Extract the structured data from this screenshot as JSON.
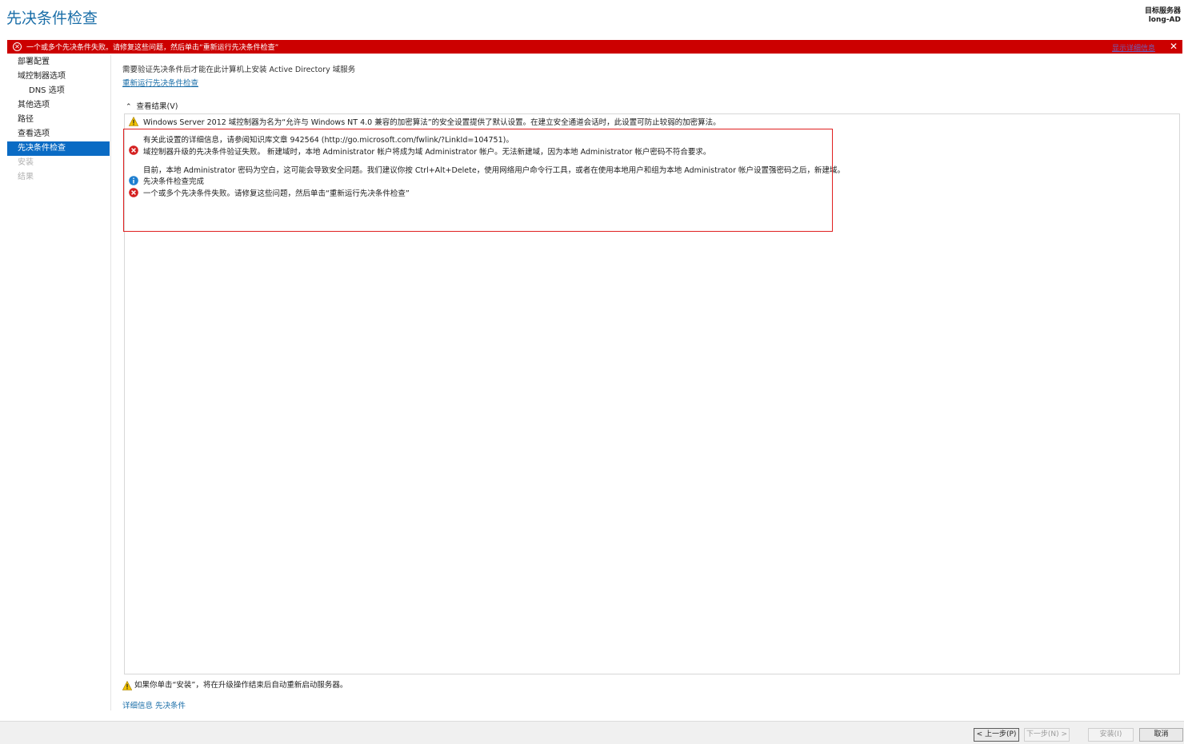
{
  "header": {
    "title": "先决条件检查",
    "target_label": "目标服务器",
    "target_server": "long-AD"
  },
  "banner": {
    "message": "一个或多个先决条件失败。请修复这些问题，然后单击“重新运行先决条件检查”",
    "detail_link": "显示详细信息",
    "close": "✕",
    "color": "#cc0000"
  },
  "nav": {
    "items": [
      {
        "label": "部署配置",
        "state": "normal"
      },
      {
        "label": "域控制器选项",
        "state": "normal"
      },
      {
        "label": "DNS 选项",
        "state": "sub"
      },
      {
        "label": "其他选项",
        "state": "normal"
      },
      {
        "label": "路径",
        "state": "normal"
      },
      {
        "label": "查看选项",
        "state": "normal"
      },
      {
        "label": "先决条件检查",
        "state": "active"
      },
      {
        "label": "安装",
        "state": "disabled"
      },
      {
        "label": "结果",
        "state": "disabled"
      }
    ]
  },
  "main": {
    "description": "需要验证先决条件后才能在此计算机上安装 Active Directory 域服务",
    "rerun_link": "重新运行先决条件检查",
    "view_results_label": "查看结果(V)",
    "results": [
      {
        "icon": "warning-icon",
        "text": "Windows Server 2012 域控制器为名为“允许与 Windows NT 4.0 兼容的加密算法”的安全设置提供了默认设置。在建立安全通道会话时，此设置可防止较弱的加密算法。"
      },
      {
        "icon": "",
        "text": "有关此设置的详细信息，请参阅知识库文章 942564 (http://go.microsoft.com/fwlink/?LinkId=104751)。"
      },
      {
        "icon": "error-icon",
        "text": "域控制器升级的先决条件验证失败。 新建域时，本地 Administrator 帐户将成为域 Administrator 帐户。无法新建域，因为本地 Administrator 帐户密码不符合要求。"
      },
      {
        "icon": "",
        "text": "目前，本地 Administrator 密码为空白，这可能会导致安全问题。我们建议你按 Ctrl+Alt+Delete，使用网络用户命令行工具，或者在使用本地用户和组为本地 Administrator 帐户设置强密码之后，新建域。"
      },
      {
        "icon": "info-icon",
        "text": "先决条件检查完成"
      },
      {
        "icon": "error-icon",
        "text": "一个或多个先决条件失败。请修复这些问题，然后单击“重新运行先决条件检查”"
      }
    ],
    "footer_warning": "如果你单击“安装”，将在升级操作结束后自动重新启动服务器。",
    "more_link": "详细信息 先决条件"
  },
  "buttons": {
    "prev": "< 上一步(P)",
    "next": "下一步(N) >",
    "install": "安装(I)",
    "cancel": "取消"
  }
}
